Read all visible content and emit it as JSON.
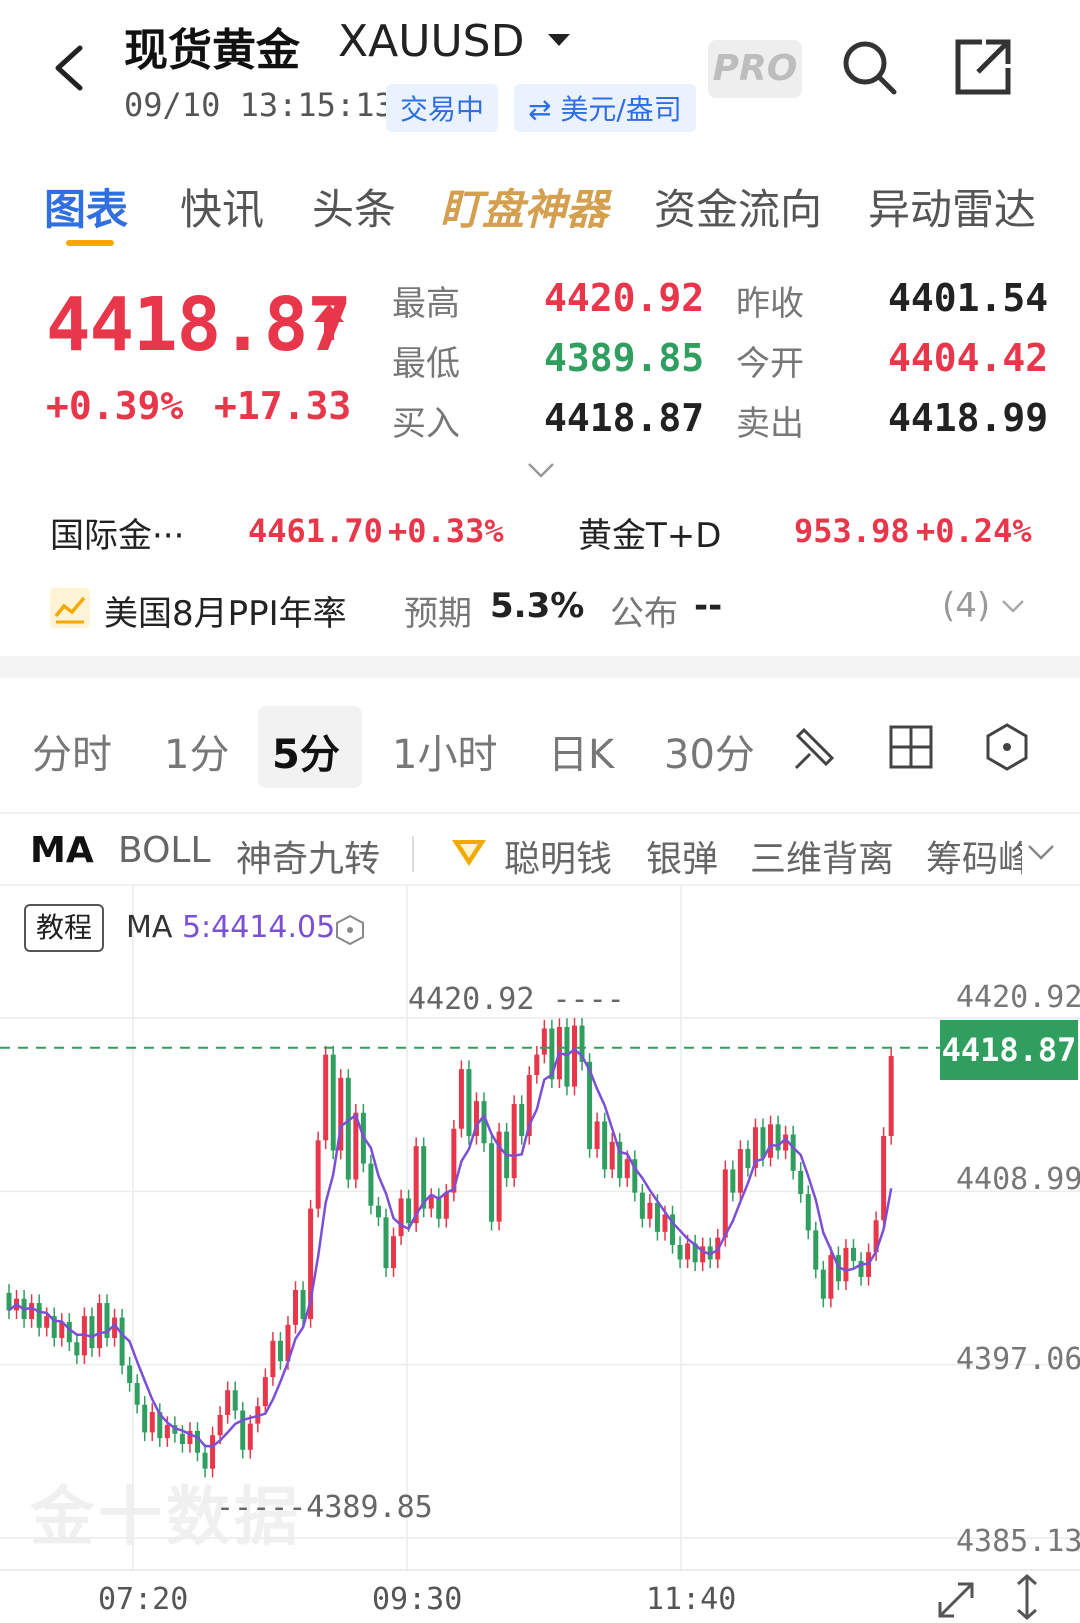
{
  "header": {
    "title": "现货黄金",
    "symbol": "XAUUSD",
    "datetime": "09/10 13:15:13",
    "status": "交易中",
    "unit": "⇄ 美元/盎司",
    "pro_label": "PRO"
  },
  "tabs": [
    "图表",
    "快讯",
    "头条",
    "盯盘神器",
    "资金流向",
    "异动雷达"
  ],
  "quote": {
    "price": "4418.87",
    "change_pct": "+0.39%",
    "change_abs": "+17.33",
    "high_label": "最高",
    "high": "4420.92",
    "low_label": "最低",
    "low": "4389.85",
    "bid_label": "买入",
    "bid": "4418.87",
    "prev_close_label": "昨收",
    "prev_close": "4401.54",
    "open_label": "今开",
    "open": "4404.42",
    "ask_label": "卖出",
    "ask": "4418.99"
  },
  "related": [
    {
      "name": "国际金···",
      "price": "4461.70",
      "change": "+0.33%"
    },
    {
      "name": "黄金T+D",
      "price": "953.98",
      "change": "+0.24%"
    }
  ],
  "event": {
    "name": "美国8月PPI年率",
    "expected_label": "预期",
    "expected": "5.3%",
    "published_label": "公布",
    "published": "--",
    "count": "(4)"
  },
  "period_tabs": [
    "分时",
    "1分",
    "5分",
    "1小时",
    "日K",
    "30分"
  ],
  "active_period": "5分",
  "indicator_tabs": [
    "MA",
    "BOLL",
    "神奇九转",
    "聪明钱",
    "银弹",
    "三维背离",
    "筹码峰"
  ],
  "chart": {
    "tutorial_label": "教程",
    "ma_prefix": "MA ",
    "ma_value": "5:4414.05",
    "high_marker": "4420.92 ----",
    "low_marker": "-----4389.85",
    "current_price": "4418.87",
    "watermark": "金十数据",
    "colors": {
      "up": "#e8364a",
      "down": "#2f9e5f",
      "ma": "#7b4fd6"
    }
  },
  "chart_data": {
    "type": "candlestick",
    "title": "",
    "ylim": [
      4385.13,
      4420.92
    ],
    "y_ticks": [
      "4420.92",
      "4408.99",
      "4397.06",
      "4385.13"
    ],
    "x_ticks": [
      "07:20",
      "09:30",
      "11:40"
    ],
    "current_price": 4418.87,
    "high": 4420.92,
    "low": 4389.85,
    "ma_period": 5,
    "ma_last": 4414.05,
    "candles": [
      [
        4402.0,
        4400.8
      ],
      [
        4400.8,
        4401.6
      ],
      [
        4401.6,
        4400.2
      ],
      [
        4400.2,
        4401.3
      ],
      [
        4401.3,
        4399.6
      ],
      [
        4399.6,
        4400.4
      ],
      [
        4400.4,
        4398.9
      ],
      [
        4398.9,
        4400.0
      ],
      [
        4400.0,
        4398.6
      ],
      [
        4398.6,
        4397.7
      ],
      [
        4397.7,
        4400.4
      ],
      [
        4400.4,
        4398.2
      ],
      [
        4398.2,
        4401.3
      ],
      [
        4401.3,
        4398.9
      ],
      [
        4398.9,
        4400.3
      ],
      [
        4400.3,
        4397.0
      ],
      [
        4397.0,
        4395.8
      ],
      [
        4395.8,
        4394.3
      ],
      [
        4394.3,
        4392.4
      ],
      [
        4392.4,
        4393.8
      ],
      [
        4393.8,
        4392.0
      ],
      [
        4392.0,
        4392.9
      ],
      [
        4392.9,
        4392.3
      ],
      [
        4392.3,
        4391.6
      ],
      [
        4391.6,
        4392.5
      ],
      [
        4392.5,
        4391.0
      ],
      [
        4391.0,
        4389.9
      ],
      [
        4389.9,
        4392.2
      ],
      [
        4392.2,
        4393.6
      ],
      [
        4393.6,
        4395.3
      ],
      [
        4395.3,
        4393.9
      ],
      [
        4393.9,
        4391.2
      ],
      [
        4391.2,
        4393.0
      ],
      [
        4393.0,
        4394.2
      ],
      [
        4394.2,
        4396.2
      ],
      [
        4396.2,
        4398.7
      ],
      [
        4398.7,
        4397.3
      ],
      [
        4397.3,
        4399.8
      ],
      [
        4399.8,
        4402.2
      ],
      [
        4402.2,
        4400.2
      ],
      [
        4400.2,
        4407.8
      ],
      [
        4407.8,
        4412.5
      ],
      [
        4412.5,
        4418.4
      ],
      [
        4418.4,
        4411.8
      ],
      [
        4411.8,
        4416.8
      ],
      [
        4416.8,
        4409.8
      ],
      [
        4409.8,
        4414.4
      ],
      [
        4414.4,
        4410.9
      ],
      [
        4410.9,
        4408.0
      ],
      [
        4408.0,
        4407.2
      ],
      [
        4407.2,
        4403.7
      ],
      [
        4403.7,
        4405.9
      ],
      [
        4405.9,
        4408.5
      ],
      [
        4408.5,
        4406.8
      ],
      [
        4406.8,
        4412.1
      ],
      [
        4412.1,
        4407.8
      ],
      [
        4407.8,
        4408.6
      ],
      [
        4408.6,
        4407.1
      ],
      [
        4407.1,
        4408.9
      ],
      [
        4408.9,
        4413.3
      ],
      [
        4413.3,
        4417.4
      ],
      [
        4417.4,
        4412.8
      ],
      [
        4412.8,
        4415.2
      ],
      [
        4415.2,
        4412.3
      ],
      [
        4412.3,
        4406.9
      ],
      [
        4406.9,
        4413.1
      ],
      [
        4413.1,
        4409.9
      ],
      [
        4409.9,
        4415.0
      ],
      [
        4415.0,
        4412.8
      ],
      [
        4412.8,
        4417.0
      ],
      [
        4417.0,
        4418.4
      ],
      [
        4418.4,
        4420.2
      ],
      [
        4420.2,
        4416.7
      ],
      [
        4416.7,
        4420.3
      ],
      [
        4420.3,
        4416.2
      ],
      [
        4416.2,
        4420.4
      ],
      [
        4420.4,
        4417.9
      ],
      [
        4417.9,
        4411.9
      ],
      [
        4411.9,
        4413.8
      ],
      [
        4413.8,
        4410.5
      ],
      [
        4410.5,
        4412.4
      ],
      [
        4412.4,
        4409.9
      ],
      [
        4409.9,
        4411.2
      ],
      [
        4411.2,
        4408.9
      ],
      [
        4408.9,
        4407.1
      ],
      [
        4407.1,
        4408.2
      ],
      [
        4408.2,
        4406.2
      ],
      [
        4406.2,
        4407.4
      ],
      [
        4407.4,
        4405.3
      ],
      [
        4405.3,
        4404.3
      ],
      [
        4404.3,
        4405.4
      ],
      [
        4405.4,
        4404.1
      ],
      [
        4404.1,
        4405.2
      ],
      [
        4405.2,
        4404.3
      ],
      [
        4404.3,
        4405.8
      ],
      [
        4405.8,
        4410.5
      ],
      [
        4410.5,
        4408.9
      ],
      [
        4408.9,
        4411.9
      ],
      [
        4411.9,
        4410.6
      ],
      [
        4410.6,
        4413.4
      ],
      [
        4413.4,
        4411.3
      ],
      [
        4411.3,
        4413.6
      ],
      [
        4413.6,
        4411.8
      ],
      [
        4411.8,
        4412.9
      ],
      [
        4412.9,
        4410.4
      ],
      [
        4410.4,
        4408.8
      ],
      [
        4408.8,
        4406.3
      ],
      [
        4406.3,
        4403.6
      ],
      [
        4403.6,
        4401.6
      ],
      [
        4401.6,
        4404.6
      ],
      [
        4404.6,
        4402.8
      ],
      [
        4402.8,
        4405.1
      ],
      [
        4405.1,
        4404.2
      ],
      [
        4404.2,
        4403.1
      ],
      [
        4403.1,
        4404.8
      ],
      [
        4404.8,
        4407.0
      ],
      [
        4407.0,
        4412.8
      ],
      [
        4412.8,
        4418.3
      ]
    ]
  }
}
